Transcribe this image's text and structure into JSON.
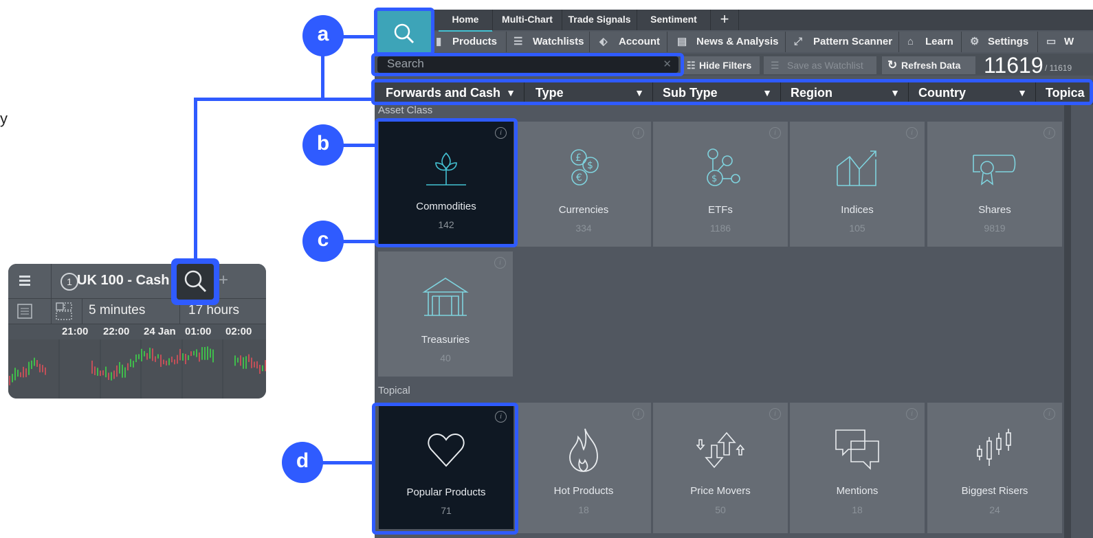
{
  "left_text": "y",
  "mini_window": {
    "number": "1",
    "title": "UK 100 - Cash",
    "interval": "5 minutes",
    "range": "17 hours",
    "times": [
      "21:00",
      "22:00",
      "24 Jan",
      "01:00",
      "02:00"
    ]
  },
  "tabs": [
    "Home",
    "Multi-Chart",
    "Trade Signals",
    "Sentiment",
    "+"
  ],
  "nav": {
    "products": "Products",
    "watchlists": "Watchlists",
    "account": "Account",
    "news": "News & Analysis",
    "pattern": "Pattern Scanner",
    "learn": "Learn",
    "settings": "Settings",
    "w": "W"
  },
  "search": {
    "placeholder": "Search",
    "clear": "✕"
  },
  "buttons": {
    "hide_filters": "Hide Filters",
    "save_watchlist": "Save as Watchlist",
    "refresh": "Refresh Data"
  },
  "count": {
    "value": "11619",
    "total": "/ 11619"
  },
  "filters": [
    "Forwards and Cash",
    "Type",
    "Sub Type",
    "Region",
    "Country",
    "Topica"
  ],
  "sections": {
    "asset_class": "Asset Class",
    "topical": "Topical"
  },
  "asset_tiles": [
    {
      "label": "Commodities",
      "count": "142",
      "icon": "plant-icon"
    },
    {
      "label": "Currencies",
      "count": "334",
      "icon": "coins-icon"
    },
    {
      "label": "ETFs",
      "count": "1186",
      "icon": "etf-icon"
    },
    {
      "label": "Indices",
      "count": "105",
      "icon": "chart-up-icon"
    },
    {
      "label": "Shares",
      "count": "9819",
      "icon": "certificate-icon"
    },
    {
      "label": "Treasuries",
      "count": "40",
      "icon": "building-icon"
    }
  ],
  "topical_tiles": [
    {
      "label": "Popular Products",
      "count": "71",
      "icon": "heart-icon"
    },
    {
      "label": "Hot Products",
      "count": "18",
      "icon": "flame-icon"
    },
    {
      "label": "Price Movers",
      "count": "50",
      "icon": "arrows-icon"
    },
    {
      "label": "Mentions",
      "count": "18",
      "icon": "speech-bubbles-icon"
    },
    {
      "label": "Biggest Risers",
      "count": "24",
      "icon": "candles-icon"
    }
  ],
  "badges": [
    "a",
    "b",
    "c",
    "d"
  ],
  "colors": {
    "highlight": "#2f5bff",
    "accent": "#44c2d3",
    "selected_tile": "#0f1823"
  }
}
